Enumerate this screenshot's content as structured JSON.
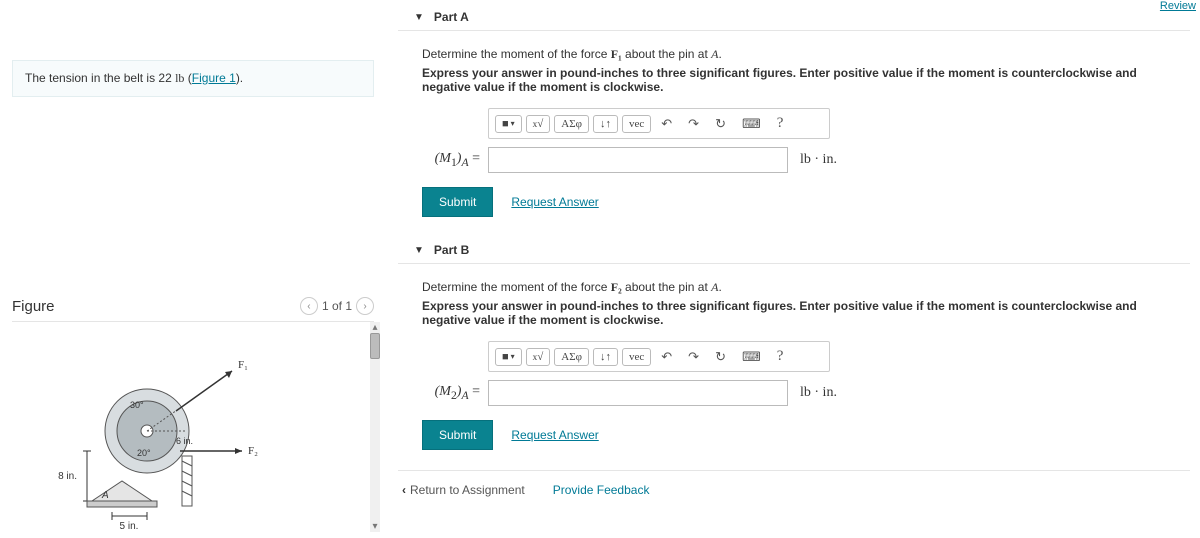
{
  "review": "Review",
  "problem": {
    "prefix": "The tension in the belt is 22 ",
    "unit": "lb",
    "open_paren": " (",
    "link": "Figure 1",
    "close": ")."
  },
  "figure": {
    "label": "Figure",
    "nav": "1 of 1",
    "dims": {
      "d1": "30°",
      "d2": "20°",
      "r": "6 in.",
      "h": "8 in.",
      "b": "5 in.",
      "f1": "F₁",
      "f2": "F₂"
    }
  },
  "partA": {
    "title": "Part A",
    "line1a": "Determine the moment of the force ",
    "line1var": "F₁",
    "line1b": " about the pin at ",
    "line1pt": "A",
    "line2": "Express your answer in pound-inches to three significant figures. Enter positive value if the moment is counterclockwise and negative value if the moment is clockwise.",
    "var": "(M₁)_A =",
    "units": "lb · in."
  },
  "partB": {
    "title": "Part B",
    "line1a": "Determine the moment of the force ",
    "line1var": "F₂",
    "line1b": " about the pin at ",
    "line1pt": "A",
    "line2": "Express your answer in pound-inches to three significant figures. Enter positive value if the moment is counterclockwise and negative value if the moment is clockwise.",
    "var": "(M₂)_A =",
    "units": "lb · in."
  },
  "toolbar": {
    "templates": "■",
    "sqrt": "√",
    "frac": "x",
    "greek": "ΑΣφ",
    "subsup": "↓↑",
    "vec": "vec",
    "undo": "↶",
    "redo": "↷",
    "reset": "↻",
    "keyboard": "⌨",
    "help": "?"
  },
  "buttons": {
    "submit": "Submit",
    "request": "Request Answer",
    "return": "Return to Assignment",
    "feedback": "Provide Feedback"
  }
}
